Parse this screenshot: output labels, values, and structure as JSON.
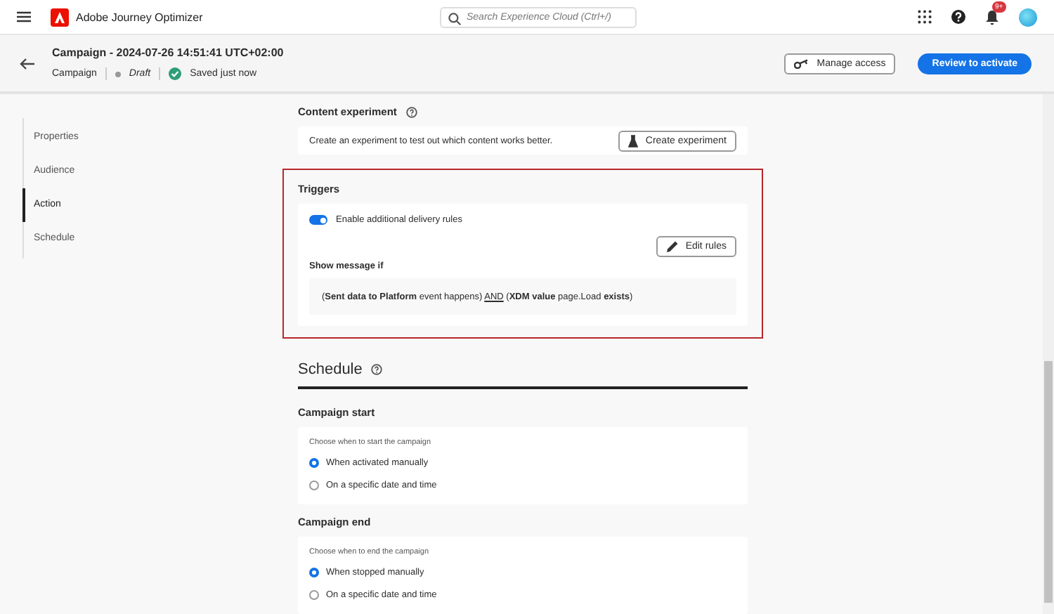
{
  "app": {
    "name": "Adobe Journey Optimizer",
    "search_placeholder": "Search Experience Cloud (Ctrl+/)",
    "notification_badge": "9+"
  },
  "header": {
    "title": "Campaign - 2024-07-26 14:51:41 UTC+02:00",
    "type": "Campaign",
    "status": "Draft",
    "saved": "Saved just now",
    "buttons": [
      {
        "label": "Manage access",
        "kind": "secondary"
      },
      {
        "label": "Review to activate",
        "kind": "primary"
      }
    ]
  },
  "sidebar": {
    "items": [
      {
        "label": "Properties",
        "selected": false
      },
      {
        "label": "Audience",
        "selected": false
      },
      {
        "label": "Action",
        "selected": true
      },
      {
        "label": "Schedule",
        "selected": false
      }
    ]
  },
  "content_experiment": {
    "title": "Content experiment",
    "description": "Create an experiment to test out which content works better.",
    "button": "Create experiment"
  },
  "triggers": {
    "title": "Triggers",
    "toggle": {
      "label": "Enable additional delivery rules",
      "on": true
    },
    "button": "Edit rules",
    "condition_label": "Show message if",
    "condition": [
      {
        "text": "(",
        "kind": "plain"
      },
      {
        "text": "Sent data to Platform",
        "kind": "field"
      },
      {
        "text": " event happens) ",
        "kind": "plain"
      },
      {
        "text": "AND",
        "kind": "operator"
      },
      {
        "text": " (",
        "kind": "plain"
      },
      {
        "text": "XDM value",
        "kind": "field"
      },
      {
        "text": " page.Load ",
        "kind": "plain"
      },
      {
        "text": "exists",
        "kind": "field"
      },
      {
        "text": ")",
        "kind": "plain"
      }
    ]
  },
  "schedule": {
    "title": "Schedule",
    "groups": [
      {
        "title": "Campaign start",
        "prompt": "Choose when to start the campaign",
        "options": [
          {
            "label": "When activated manually",
            "selected": true
          },
          {
            "label": "On a specific date and time",
            "selected": false
          }
        ]
      },
      {
        "title": "Campaign end",
        "prompt": "Choose when to end the campaign",
        "options": [
          {
            "label": "When stopped manually",
            "selected": true
          },
          {
            "label": "On a specific date and time",
            "selected": false
          }
        ]
      }
    ]
  }
}
